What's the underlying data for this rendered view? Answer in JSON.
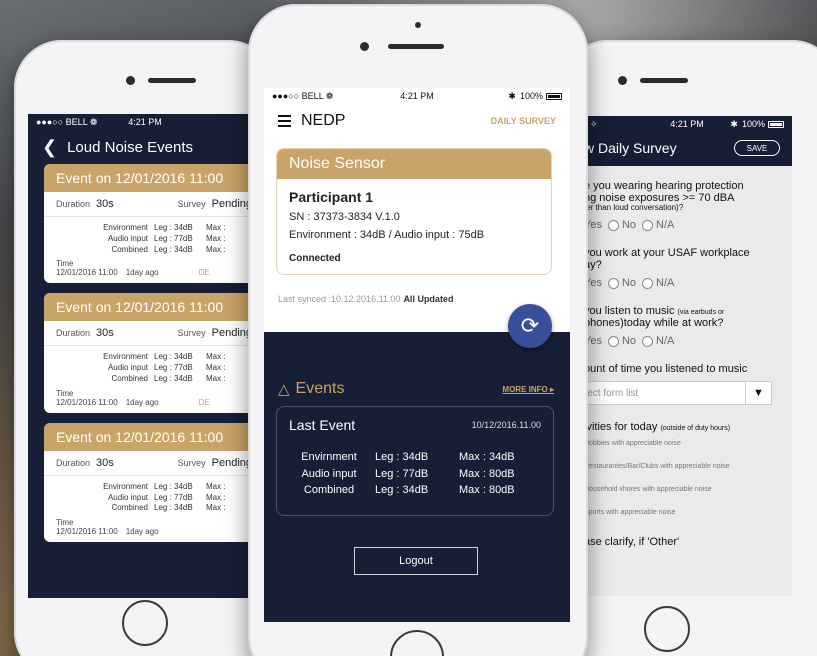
{
  "left": {
    "status": {
      "carrier": "●●●○○ BELL ❁",
      "time": "4:21 PM"
    },
    "title": "Loud Noise Events",
    "events": [
      {
        "title": "Event on 12/01/2016 11:00",
        "duration_label": "Duration",
        "duration": "30s",
        "survey_label": "Survey",
        "survey": "Pending",
        "rows": [
          [
            "Environment",
            "Leg : 34dB",
            "Max :"
          ],
          [
            "Audio input",
            "Leg : 77dB",
            "Max :"
          ],
          [
            "Combined",
            "Leg : 34dB",
            "Max :"
          ]
        ],
        "time_label": "Time",
        "time": "12/01/2016 11:00",
        "ago": "1day ago",
        "tail": "DE"
      },
      {
        "title": "Event on 12/01/2016 11:00",
        "duration_label": "Duration",
        "duration": "30s",
        "survey_label": "Survey",
        "survey": "Pending",
        "rows": [
          [
            "Environment",
            "Leg : 34dB",
            "Max :"
          ],
          [
            "Audio input",
            "Leg : 77dB",
            "Max :"
          ],
          [
            "Combined",
            "Leg : 34dB",
            "Max :"
          ]
        ],
        "time_label": "Time",
        "time": "12/01/2016 11:00",
        "ago": "1day ago",
        "tail": "DE"
      },
      {
        "title": "Event on 12/01/2016 11:00",
        "duration_label": "Duration",
        "duration": "30s",
        "survey_label": "Survey",
        "survey": "Pending",
        "rows": [
          [
            "Environment",
            "Leg : 34dB",
            "Max :"
          ],
          [
            "Audio input",
            "Leg : 77dB",
            "Max :"
          ],
          [
            "Combined",
            "Leg : 34dB",
            "Max :"
          ]
        ],
        "time_label": "Time",
        "time": "12/01/2016 11:00",
        "ago": "1day ago",
        "tail": ""
      }
    ]
  },
  "center": {
    "status": {
      "carrier": "●●●○○ BELL ❁",
      "time": "4:21 PM",
      "battery": "100%"
    },
    "app_title": "NEDP",
    "daily_survey": "DAILY SURVEY",
    "sensor": {
      "title": "Noise Sensor",
      "participant": "Participant 1",
      "sn": "SN : 37373-3834 V.1.0",
      "environment": "Environment : 34dB / Audio input : 75dB",
      "connection": "Connected"
    },
    "synced": {
      "text": "Last synced :10.12.2016.11.00",
      "state": "All Updated"
    },
    "events_title": "Events",
    "more_info": "MORE INFO ▸",
    "last_event": {
      "title": "Last Event",
      "date": "10/12/2016.11.00",
      "rows": [
        [
          "Envirnment",
          "Leg : 34dB",
          "Max : 34dB"
        ],
        [
          "Audio input",
          "Leg : 77dB",
          "Max : 80dB"
        ],
        [
          "Combined",
          "Leg : 34dB",
          "Max : 80dB"
        ]
      ]
    },
    "logout": "Logout"
  },
  "right": {
    "status": {
      "time": "4:21 PM",
      "battery": "100%"
    },
    "title": "w Daily Survey",
    "save": "SAVE",
    "q1": {
      "line1": "e you wearing hearing protection",
      "line2": "ng noise exposures >= 70 dBA",
      "line3": "ter than loud conversation)?"
    },
    "q2": {
      "line1": "you work at your USAF workplace",
      "line2": "ay?"
    },
    "q3": {
      "line1": "you listen to music",
      "hint": "(via earbuds or",
      "line2": "phones)today while at work?"
    },
    "radio_labels": [
      "Yes",
      "No",
      "N/A"
    ],
    "q4": "ount of time you listened to music",
    "select_placeholder": "lect form list",
    "q5": {
      "text": "ivities for today",
      "hint": "(outside of duty hours)"
    },
    "activities": [
      "Hobbies with appreciable noise",
      "Restaurantes/Bar/Clubs with appreciable noise",
      "Household xhores with appreciable noise",
      "Sports with appreciable noise"
    ],
    "q6": "ase clarify, if 'Other'"
  }
}
